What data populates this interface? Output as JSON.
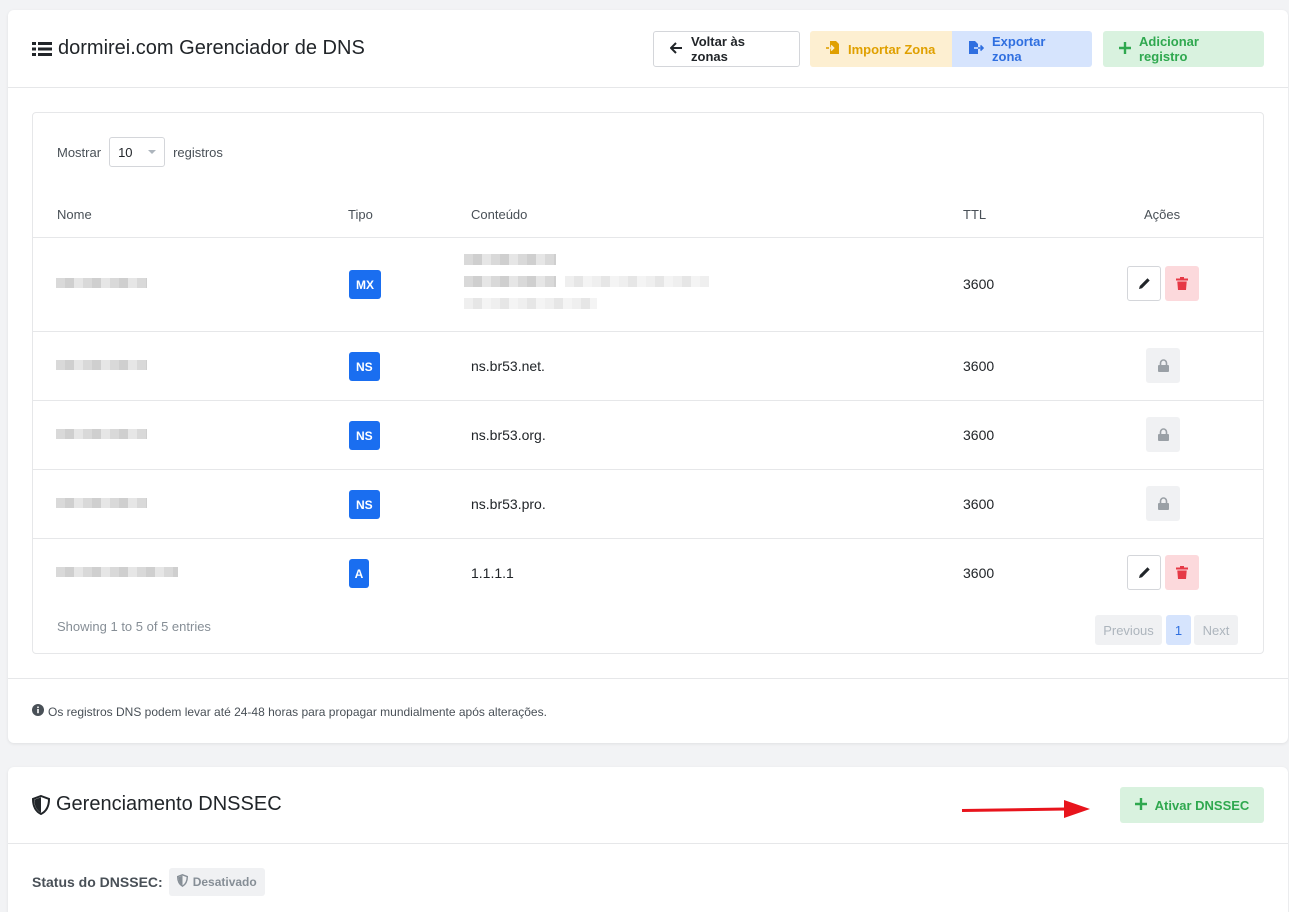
{
  "dns": {
    "title": "dormirei.com Gerenciador de DNS",
    "buttons": {
      "back": "Voltar às zonas",
      "import": "Importar Zona",
      "export": "Exportar zona",
      "add": "Adicionar registro"
    },
    "length": {
      "prefix": "Mostrar",
      "value": "10",
      "suffix": "registros"
    },
    "columns": {
      "name": "Nome",
      "type": "Tipo",
      "content": "Conteúdo",
      "ttl": "TTL",
      "actions": "Ações"
    },
    "rows": [
      {
        "type": "MX",
        "content": "",
        "ttl": "3600"
      },
      {
        "type": "NS",
        "content": "ns.br53.net.",
        "ttl": "3600"
      },
      {
        "type": "NS",
        "content": "ns.br53.org.",
        "ttl": "3600"
      },
      {
        "type": "NS",
        "content": "ns.br53.pro.",
        "ttl": "3600"
      },
      {
        "type": "A",
        "content": "1.1.1.1",
        "ttl": "3600"
      }
    ],
    "info": "Showing 1 to 5 of 5 entries",
    "pagination": {
      "previous": "Previous",
      "current": "1",
      "next": "Next"
    },
    "note": "Os registros DNS podem levar até 24-48 horas para propagar mundialmente após alterações."
  },
  "dnssec": {
    "title": "Gerenciamento DNSSEC",
    "button": "Ativar DNSSEC",
    "status_label": "Status do DNSSEC:",
    "status_value": "Desativado"
  },
  "colors": {
    "primary": "#1a6ef0",
    "success": "#2fa84f",
    "warning": "#e0a000",
    "danger": "#e63946",
    "annotation_arrow": "#e8141c"
  }
}
